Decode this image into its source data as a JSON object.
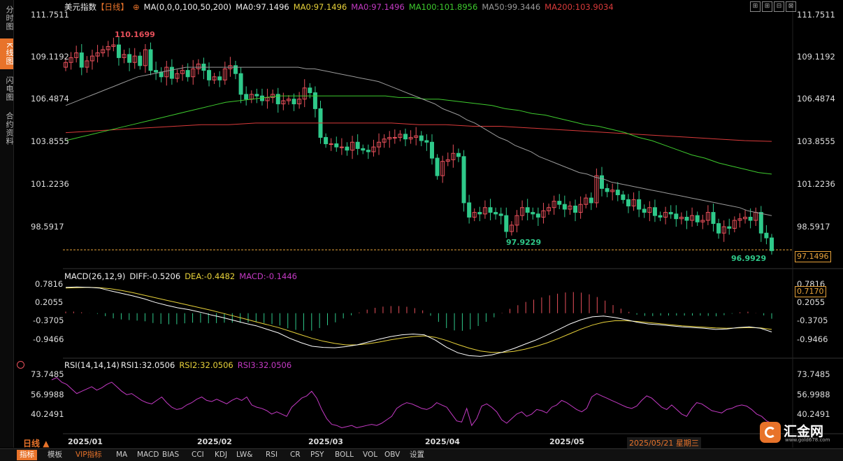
{
  "sidebar": {
    "items": [
      "分时图",
      "K线图",
      "闪电图",
      "合约资料"
    ],
    "active": 1
  },
  "header": {
    "title": "美元指数",
    "period": "【日线】",
    "circle_icon": "⊕",
    "ma_param": "MA(0,0,0,100,50,200)",
    "ma_main": "MA0:97.1496",
    "ma_yellow": "MA0:97.1496",
    "ma_magenta": "MA0:97.1496",
    "ma100": "MA100:101.8956",
    "ma50": "MA50:99.3446",
    "ma200": "MA200:103.9034"
  },
  "window_buttons": [
    "⊞",
    "⊞",
    "⊟",
    "⊠"
  ],
  "price_axis": {
    "left": [
      "111.7511",
      "109.1192",
      "106.4874",
      "103.8555",
      "101.2236",
      "98.5917"
    ],
    "right": [
      "111.7511",
      "109.1192",
      "106.4874",
      "103.8555",
      "101.2236",
      "98.5917"
    ],
    "current": "97.1496"
  },
  "annotations": {
    "high": "110.1699",
    "low1": "97.9229",
    "low2": "96.9929"
  },
  "macd": {
    "title": "MACD(26,12,9)",
    "diff": "DIFF:-0.5206",
    "dea": "DEA:-0.4482",
    "macd": "MACD:-0.1446",
    "ticks_left": [
      "0.7816",
      "0.2055",
      "-0.3705",
      "-0.9466"
    ],
    "ticks_right": [
      "0.7816",
      "0.2055",
      "-0.3705",
      "-0.9466"
    ],
    "tag": "0.7170"
  },
  "rsi": {
    "title": "RSI(14,14,14)",
    "rsi1": "RSI1:32.0506",
    "rsi2": "RSI2:32.0506",
    "rsi3": "RSI3:32.0506",
    "ticks_left": [
      "73.7485",
      "56.9988",
      "40.2491"
    ],
    "ticks_right": [
      "73.7485",
      "56.9988",
      "40.2491"
    ]
  },
  "xaxis": {
    "labels": [
      "2025/01",
      "2025/02",
      "2025/03",
      "2025/04",
      "2025/05"
    ],
    "date": "2025/05/21 星期三",
    "period_label": "日线"
  },
  "bottom_tabs": [
    "指标",
    "模板",
    "VIP指标",
    "MA",
    "MACD",
    "BIAS",
    "CCI",
    "KDJ",
    "LW&",
    "RSI",
    "CR",
    "PSY",
    "BOLL",
    "VOL",
    "OBV",
    "设置"
  ],
  "logo": {
    "name": "汇金网",
    "url": "www.gold678.com"
  },
  "colors": {
    "up": "#e8505b",
    "down": "#2fc98a",
    "ma50": "#9a9a9a",
    "ma100": "#3ecb2e",
    "ma200": "#d93a3a",
    "orange": "#e8732a",
    "dif": "#ffffff",
    "dea": "#e8d23a",
    "rsi": "#c43ac4"
  },
  "chart_data": {
    "type": "candlestick",
    "price_range": [
      96.5,
      112.2
    ],
    "closes": [
      108.9,
      109.2,
      109.5,
      108.6,
      109.0,
      109.3,
      109.5,
      109.7,
      109.9,
      110.0,
      109.2,
      109.4,
      108.9,
      109.3,
      108.7,
      109.7,
      108.4,
      108.3,
      108.0,
      108.6,
      107.9,
      108.2,
      108.4,
      108.0,
      108.5,
      108.8,
      108.4,
      107.8,
      108.0,
      107.8,
      108.5,
      108.7,
      108.2,
      106.9,
      106.6,
      106.9,
      106.8,
      106.5,
      106.7,
      106.9,
      106.3,
      106.5,
      106.6,
      106.3,
      106.6,
      107.3,
      107.0,
      106.0,
      104.2,
      103.8,
      103.8,
      103.6,
      103.6,
      103.4,
      103.9,
      103.5,
      103.4,
      103.3,
      103.6,
      103.9,
      104.1,
      104.2,
      104.2,
      104.4,
      104.1,
      104.2,
      104.3,
      104.0,
      103.9,
      102.9,
      101.8,
      102.7,
      102.8,
      103.2,
      103.0,
      100.1,
      99.2,
      99.5,
      99.4,
      99.8,
      99.5,
      99.4,
      99.3,
      98.3,
      98.7,
      99.3,
      99.8,
      99.5,
      99.4,
      99.2,
      99.6,
      99.8,
      100.2,
      100.0,
      99.7,
      99.9,
      99.5,
      100.0,
      100.4,
      100.1,
      101.8,
      101.0,
      100.8,
      100.9,
      100.6,
      100.3,
      99.9,
      100.3,
      99.7,
      99.5,
      99.8,
      99.3,
      99.2,
      99.5,
      99.4,
      99.1,
      99.2,
      99.0,
      99.3,
      98.9,
      99.0,
      99.5,
      98.8,
      98.2,
      98.6,
      98.5,
      99.0,
      99.1,
      99.2,
      99.0,
      99.5,
      98.2,
      97.9,
      97.1
    ],
    "ma50": [
      106.2,
      106.4,
      106.6,
      106.8,
      107.0,
      107.2,
      107.4,
      107.6,
      107.8,
      108.0,
      108.1,
      108.2,
      108.3,
      108.4,
      108.5,
      108.6,
      108.6,
      108.6,
      108.6,
      108.6,
      108.6,
      108.6,
      108.6,
      108.6,
      108.6,
      108.6,
      108.6,
      108.6,
      108.6,
      108.6,
      108.5,
      108.5,
      108.4,
      108.3,
      108.2,
      108.1,
      108.0,
      107.9,
      107.8,
      107.7,
      107.5,
      107.3,
      107.1,
      106.9,
      106.7,
      106.5,
      106.3,
      106.0,
      105.8,
      105.6,
      105.3,
      105.1,
      104.8,
      104.5,
      104.2,
      104.0,
      103.7,
      103.5,
      103.3,
      103.0,
      102.8,
      102.6,
      102.4,
      102.2,
      102.0,
      101.9,
      101.7,
      101.6,
      101.4,
      101.3,
      101.2,
      101.1,
      101.0,
      100.9,
      100.8,
      100.7,
      100.6,
      100.5,
      100.4,
      100.3,
      100.2,
      100.1,
      100.0,
      99.9,
      99.8,
      99.6,
      99.5,
      99.4,
      99.3
    ],
    "ma100": [
      104.0,
      104.2,
      104.4,
      104.6,
      104.8,
      105.0,
      105.2,
      105.4,
      105.6,
      105.8,
      106.0,
      106.2,
      106.4,
      106.5,
      106.6,
      106.7,
      106.8,
      106.8,
      106.8,
      106.8,
      106.8,
      106.8,
      106.8,
      106.8,
      106.8,
      106.7,
      106.7,
      106.6,
      106.6,
      106.5,
      106.4,
      106.3,
      106.2,
      106.0,
      105.9,
      105.7,
      105.6,
      105.4,
      105.2,
      105.0,
      104.9,
      104.7,
      104.5,
      104.2,
      104.0,
      103.7,
      103.4,
      103.1,
      102.9,
      102.6,
      102.4,
      102.2,
      102.0,
      101.9
    ],
    "ma200": [
      104.5,
      104.6,
      104.7,
      104.8,
      104.9,
      105.0,
      105.0,
      105.1,
      105.1,
      105.1,
      105.1,
      105.1,
      105.1,
      105.0,
      105.0,
      104.9,
      104.9,
      104.8,
      104.7,
      104.6,
      104.5,
      104.4,
      104.3,
      104.2,
      104.1,
      104.0,
      103.95
    ],
    "macd_dif": [
      0.72,
      0.73,
      0.72,
      0.7,
      0.62,
      0.55,
      0.48,
      0.4,
      0.3,
      0.22,
      0.15,
      0.1,
      0.03,
      -0.05,
      -0.12,
      -0.2,
      -0.28,
      -0.35,
      -0.45,
      -0.55,
      -0.7,
      -0.82,
      -0.92,
      -0.95,
      -0.96,
      -0.93,
      -0.88,
      -0.8,
      -0.72,
      -0.65,
      -0.6,
      -0.58,
      -0.6,
      -0.75,
      -0.95,
      -1.1,
      -1.18,
      -1.2,
      -1.16,
      -1.08,
      -0.98,
      -0.86,
      -0.74,
      -0.6,
      -0.45,
      -0.3,
      -0.18,
      -0.1,
      -0.08,
      -0.12,
      -0.18,
      -0.25,
      -0.3,
      -0.32,
      -0.35,
      -0.38,
      -0.4,
      -0.42,
      -0.45,
      -0.44,
      -0.4,
      -0.38,
      -0.42,
      -0.52
    ],
    "macd_dea": [
      0.7,
      0.71,
      0.72,
      0.71,
      0.68,
      0.63,
      0.57,
      0.5,
      0.43,
      0.36,
      0.29,
      0.22,
      0.15,
      0.08,
      0.0,
      -0.08,
      -0.16,
      -0.24,
      -0.32,
      -0.4,
      -0.5,
      -0.6,
      -0.7,
      -0.78,
      -0.84,
      -0.88,
      -0.88,
      -0.85,
      -0.8,
      -0.74,
      -0.69,
      -0.65,
      -0.63,
      -0.67,
      -0.76,
      -0.87,
      -0.97,
      -1.05,
      -1.09,
      -1.09,
      -1.06,
      -1.0,
      -0.92,
      -0.82,
      -0.7,
      -0.57,
      -0.44,
      -0.33,
      -0.25,
      -0.21,
      -0.21,
      -0.23,
      -0.26,
      -0.29,
      -0.32,
      -0.35,
      -0.37,
      -0.39,
      -0.41,
      -0.42,
      -0.41,
      -0.4,
      -0.41,
      -0.45
    ],
    "rsi": [
      70,
      72,
      68,
      66,
      62,
      58,
      60,
      62,
      64,
      61,
      63,
      66,
      68,
      64,
      60,
      57,
      58,
      55,
      52,
      50,
      49,
      52,
      55,
      50,
      46,
      44,
      45,
      48,
      50,
      53,
      55,
      52,
      51,
      53,
      51,
      49,
      52,
      54,
      52,
      55,
      48,
      46,
      45,
      43,
      40,
      42,
      40,
      38,
      46,
      50,
      54,
      56,
      60,
      54,
      44,
      36,
      31,
      30,
      28,
      29,
      30,
      28,
      29,
      30,
      31,
      30,
      32,
      35,
      38,
      45,
      48,
      50,
      49,
      47,
      45,
      44,
      46,
      50,
      48,
      46,
      40,
      34,
      33,
      45,
      30,
      36,
      47,
      49,
      46,
      42,
      35,
      32,
      36,
      40,
      42,
      38,
      40,
      44,
      43,
      41,
      46,
      48,
      52,
      50,
      47,
      44,
      42,
      45,
      55,
      58,
      56,
      54,
      52,
      50,
      48,
      46,
      45,
      47,
      52,
      56,
      54,
      50,
      46,
      44,
      48,
      44,
      40,
      38,
      45,
      50,
      49,
      46,
      43,
      42,
      41,
      44,
      45,
      47,
      48,
      47,
      44,
      40,
      38,
      34,
      32
    ]
  }
}
